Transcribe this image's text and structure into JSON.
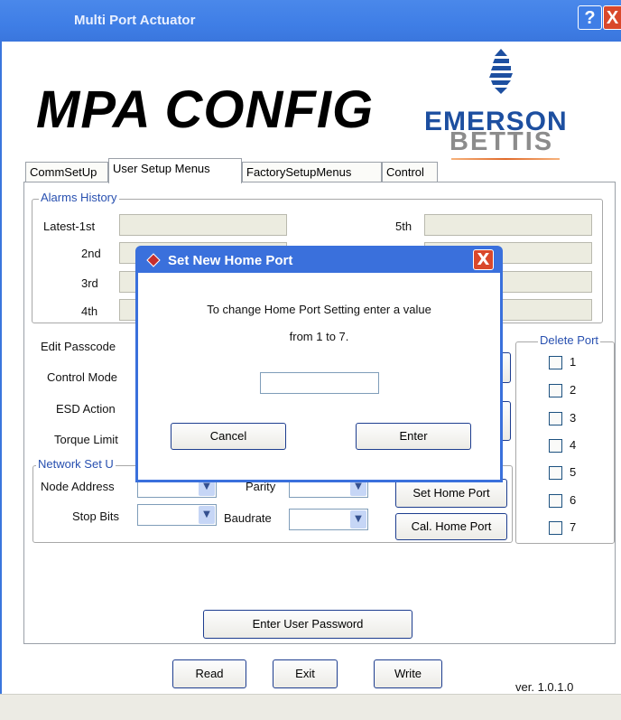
{
  "window": {
    "title": "Multi Port Actuator",
    "help_label": "?",
    "close_label": "X"
  },
  "header": {
    "app_title": "MPA CONFIG",
    "brand_top": "EMERSON",
    "brand_bottom": "BETTIS"
  },
  "tabs": [
    {
      "label": "CommSetUp"
    },
    {
      "label": "User Setup Menus"
    },
    {
      "label": "FactorySetupMenus"
    },
    {
      "label": "Control"
    }
  ],
  "alarms": {
    "group_title": "Alarms History",
    "labels": [
      "Latest-1st",
      "2nd",
      "3rd",
      "4th",
      "5th"
    ]
  },
  "settings": {
    "edit_passcode": "Edit Passcode",
    "control_mode": "Control Mode",
    "esd_action": "ESD Action",
    "torque_limit": "Torque Limit"
  },
  "network": {
    "group_title": "Network Set U",
    "node_address": "Node Address",
    "parity": "Parity",
    "stop_bits": "Stop Bits",
    "baudrate": "Baudrate",
    "set_home_port": "Set Home Port",
    "cal_home_port": "Cal. Home Port"
  },
  "delete_port": {
    "group_title": "Delete Port",
    "items": [
      "1",
      "2",
      "3",
      "4",
      "5",
      "6",
      "7"
    ]
  },
  "enter_user_password": "Enter User Password",
  "footer": {
    "read": "Read",
    "exit": "Exit",
    "write": "Write",
    "version": "ver. 1.0.1.0"
  },
  "dialog": {
    "title": "Set New Home Port",
    "line1": "To change Home Port Setting enter a value",
    "line2": "from 1 to 7.",
    "input_value": "",
    "cancel": "Cancel",
    "enter": "Enter",
    "close_label": "X"
  }
}
